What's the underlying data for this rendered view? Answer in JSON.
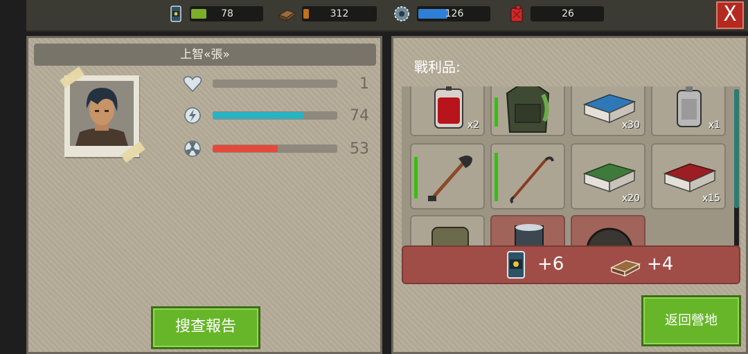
{
  "resources": {
    "food": {
      "icon": "food-can-icon",
      "value": "78",
      "level": 0.1
    },
    "wood": {
      "icon": "wood-plank-icon",
      "value": "312",
      "level": 0.1
    },
    "parts": {
      "icon": "gear-icon",
      "value": "126",
      "level": 0.6
    },
    "fuel": {
      "icon": "fuel-canister-icon",
      "value": "26",
      "level": 0.0
    }
  },
  "close_button": {
    "label": "X"
  },
  "character": {
    "name": "上智«張»",
    "stats": [
      {
        "icon": "heart-icon",
        "value": "1",
        "fill": 0.01,
        "color": "#7b9e5f"
      },
      {
        "icon": "energy-bolt-icon",
        "value": "74",
        "fill": 0.74,
        "color": "#27b3c4"
      },
      {
        "icon": "radiation-icon",
        "value": "53",
        "fill": 0.53,
        "color": "#e5493c"
      }
    ]
  },
  "report_button": {
    "label": "搜查報告"
  },
  "loot": {
    "title": "戰利品:",
    "items": [
      {
        "name": "blood-bag-icon",
        "qty": "x2",
        "durability": 0
      },
      {
        "name": "vest-icon",
        "qty": "",
        "durability": 0.7
      },
      {
        "name": "blue-cloth-bundle-icon",
        "qty": "x30",
        "durability": 0
      },
      {
        "name": "canister-icon",
        "qty": "x1",
        "durability": 0
      },
      {
        "name": "shovel-icon",
        "qty": "",
        "durability": 0.6
      },
      {
        "name": "crowbar-icon",
        "qty": "",
        "durability": 0.95
      },
      {
        "name": "green-cloth-bundle-icon",
        "qty": "x20",
        "durability": 0
      },
      {
        "name": "red-cloth-bundle-icon",
        "qty": "x15",
        "durability": 0
      },
      {
        "name": "backpack-icon",
        "qty": "",
        "durability": 0
      },
      {
        "name": "metal-barrel-icon",
        "qty": "",
        "durability": 0
      },
      {
        "name": "tire-icon",
        "qty": "",
        "durability": 0
      }
    ],
    "summary": [
      {
        "icon": "food-can-icon",
        "value": "+6"
      },
      {
        "icon": "wood-plank-icon",
        "value": "+4"
      }
    ]
  },
  "return_button": {
    "label": "返回營地"
  }
}
